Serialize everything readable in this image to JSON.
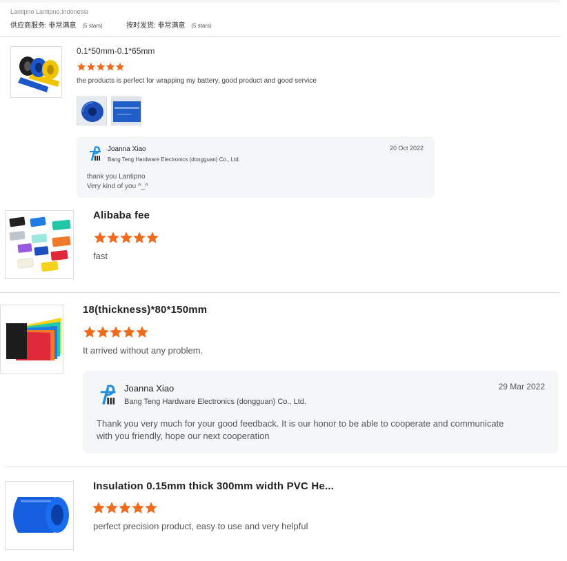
{
  "header": {
    "reviewer": "Lantipno Lantipno,Indonesia",
    "supplier_service_label": "供应商服务:",
    "supplier_service_value": "非常满意",
    "supplier_service_stars": "(5 stars)",
    "ontime_label": "按时发货:",
    "ontime_value": "非常满意",
    "ontime_stars": "(5 stars)"
  },
  "colors": {
    "star": "#f26a1b",
    "reply_bg": "#f5f6f8",
    "divider": "#d9d9d9",
    "logo_blue": "#1f8fe0"
  },
  "reviews": [
    {
      "title": "0.1*50mm-0.1*65mm",
      "rating": 5,
      "comment": "the products is perfect for wrapping my battery, good product and good service",
      "photos": [
        "blue-roll-photo",
        "blue-sheet-photo"
      ],
      "reply": {
        "name": "Joanna Xiao",
        "company": "Bang Teng Hardware Electronics (dongguan) Co., Ltd.",
        "date": "20 Oct 2022",
        "lines": [
          "thank you Lantipno",
          "Very kind of you ^_^"
        ]
      }
    },
    {
      "title": "Alibaba fee",
      "rating": 5,
      "comment": "fast"
    },
    {
      "title": "18(thickness)*80*150mm",
      "rating": 5,
      "comment": "It arrived without any problem.",
      "reply": {
        "name": "Joanna Xiao",
        "company": "Bang Teng Hardware Electronics (dongguan) Co., Ltd.",
        "date": "29 Mar 2022",
        "lines": [
          "Thank you very much for your good feedback. It is our honor to be able to cooperate and communicate",
          "with you friendly, hope our next cooperation"
        ]
      }
    },
    {
      "title": "Insulation 0.15mm thick 300mm width PVC He...",
      "rating": 5,
      "comment": "perfect precision product, easy to use and very helpful"
    }
  ]
}
